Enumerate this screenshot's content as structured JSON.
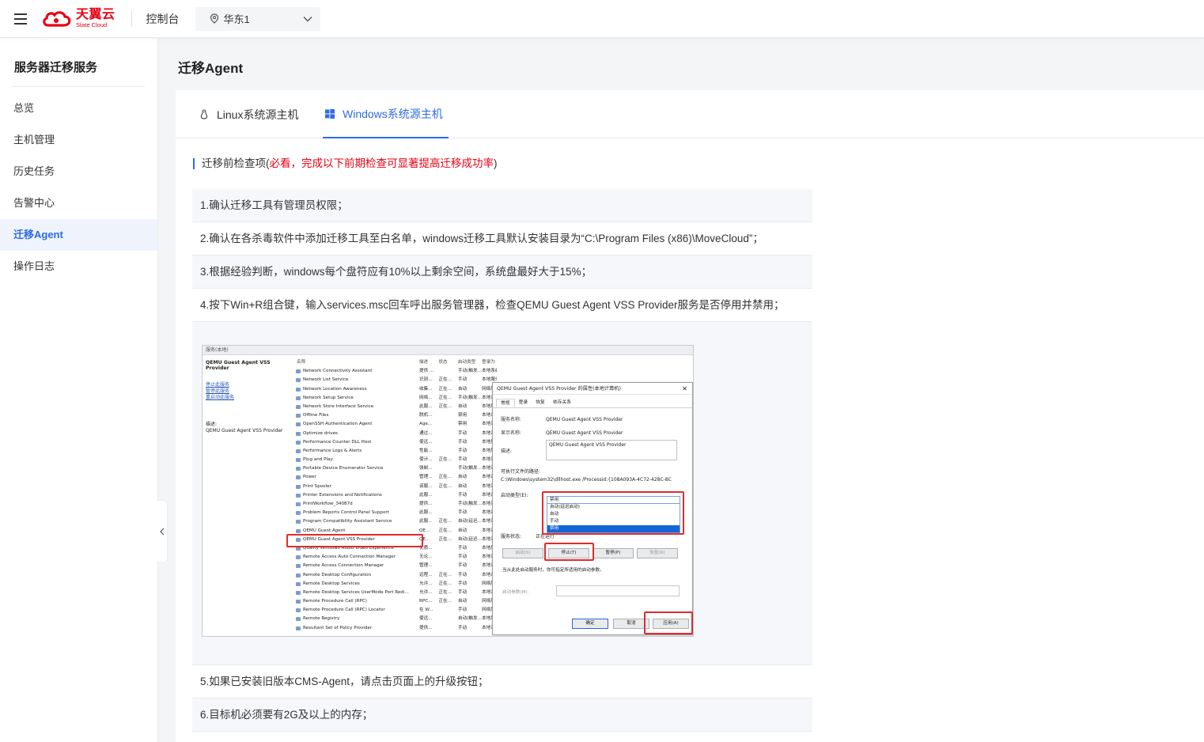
{
  "topbar": {
    "logo_cn": "天翼云",
    "logo_en": "State Cloud",
    "console_label": "控制台",
    "region": "华东1"
  },
  "sidebar": {
    "title": "服务器迁移服务",
    "items": [
      {
        "label": "总览"
      },
      {
        "label": "主机管理"
      },
      {
        "label": "历史任务"
      },
      {
        "label": "告警中心"
      },
      {
        "label": "迁移Agent",
        "active": true
      },
      {
        "label": "操作日志"
      }
    ]
  },
  "page": {
    "title": "迁移Agent",
    "tabs": [
      {
        "label": "Linux系统源主机",
        "icon": "linux-icon",
        "active": false
      },
      {
        "label": "Windows系统源主机",
        "icon": "windows-icon",
        "active": true
      }
    ],
    "precheck": {
      "prefix": "迁移前检查项(",
      "warning": "必看，完成以下前期检查可显著提高迁移成功率",
      "suffix": ")"
    },
    "steps": [
      "1.确认迁移工具有管理员权限；",
      "2.确认在各杀毒软件中添加迁移工具至白名单，windows迁移工具默认安装目录为“C:\\Program Files (x86)\\MoveCloud”；",
      "3.根据经验判断，windows每个盘符应有10%以上剩余空间，系统盘最好大于15%；",
      "4.按下Win+R组合键，输入services.msc回车呼出服务管理器，检查QEMU Guest Agent VSS Provider服务是否停用并禁用；",
      "5.如果已安装旧版本CMS-Agent，请点击页面上的升级按钮；",
      "6.目标机必须要有2G及以上的内存；"
    ]
  },
  "screenshot": {
    "window_title": "服务(本地)",
    "left_title": "QEMU Guest Agent VSS Provider",
    "left_links": [
      "停止此服务",
      "暂停此服务",
      "重启动此服务"
    ],
    "left_desc_label": "描述:",
    "left_desc": "QEMU Guest Agent VSS Provider",
    "columns": [
      "名称",
      "描述",
      "状态",
      "启动类型",
      "登录为"
    ],
    "services": [
      [
        "Network Connectivity Assistant",
        "提供 ...",
        "",
        "手动(触发...",
        "本地系统"
      ],
      [
        "Network List Service",
        "识别...",
        "正在...",
        "手动",
        "本地服务"
      ],
      [
        "Network Location Awareness",
        "收集...",
        "正在...",
        "自动",
        "网络服务"
      ],
      [
        "Network Setup Service",
        "网络...",
        "正在...",
        "手动(触发...",
        "本地系统"
      ],
      [
        "Network Store Interface Service",
        "此服...",
        "正在...",
        "自动",
        "本地服务"
      ],
      [
        "Offline Files",
        "脱机...",
        "",
        "禁用",
        "本地系统"
      ],
      [
        "OpenSSH Authentication Agent",
        "Age...",
        "",
        "禁用",
        "本地系统"
      ],
      [
        "Optimize drives",
        "通过...",
        "",
        "手动",
        "本地系统"
      ],
      [
        "Performance Counter DLL Host",
        "使远...",
        "",
        "手动",
        "本地服务"
      ],
      [
        "Performance Logs & Alerts",
        "性能...",
        "",
        "手动",
        "本地服务"
      ],
      [
        "Plug and Play",
        "使计...",
        "正在...",
        "手动",
        "本地系统"
      ],
      [
        "Portable Device Enumerator Service",
        "强制...",
        "",
        "手动(触发...",
        "本地系统"
      ],
      [
        "Power",
        "管理...",
        "正在...",
        "自动",
        "本地系统"
      ],
      [
        "Print Spooler",
        "该服...",
        "正在...",
        "自动",
        "本地系统"
      ],
      [
        "Printer Extensions and Notifications",
        "此服...",
        "",
        "手动",
        "本地系统"
      ],
      [
        "PrintWorkflow_34087d",
        "提供...",
        "",
        "手动(触发...",
        "本地系统"
      ],
      [
        "Problem Reports Control Panel Support",
        "此服...",
        "",
        "手动",
        "本地系统"
      ],
      [
        "Program Compatibility Assistant Service",
        "此服...",
        "正在...",
        "自动(延迟...",
        "本地系统"
      ],
      [
        "QEMU Guest Agent",
        "QE...",
        "正在...",
        "自动",
        "本地系统"
      ],
      [
        "QEMU Guest Agent VSS Provider",
        "QE...",
        "正在...",
        "自动(延迟...",
        "本地系统"
      ],
      [
        "Quality Windows Audio Video Experience",
        "优质...",
        "",
        "手动",
        "本地服务"
      ],
      [
        "Remote Access Auto Connection Manager",
        "无论...",
        "",
        "手动",
        "本地系统"
      ],
      [
        "Remote Access Connection Manager",
        "管理...",
        "",
        "手动",
        "本地系统"
      ],
      [
        "Remote Desktop Configuration",
        "远程...",
        "正在...",
        "手动",
        "本地系统"
      ],
      [
        "Remote Desktop Services",
        "允许...",
        "正在...",
        "手动",
        "网络服务"
      ],
      [
        "Remote Desktop Services UserMode Port Redi...",
        "允许...",
        "正在...",
        "手动",
        "本地系统"
      ],
      [
        "Remote Procedure Call (RPC)",
        "RPC...",
        "正在...",
        "自动",
        "网络服务"
      ],
      [
        "Remote Procedure Call (RPC) Locator",
        "在 W...",
        "",
        "手动",
        "网络服务"
      ],
      [
        "Remote Registry",
        "使远...",
        "",
        "自动(触发...",
        "本地服务"
      ],
      [
        "Resultant Set of Policy Provider",
        "提供...",
        "",
        "手动",
        "本地系统"
      ]
    ],
    "dialog": {
      "title": "QEMU Guest Agent VSS Provider 的属性(本地计算机)",
      "tabs": [
        "常规",
        "登录",
        "恢复",
        "依存关系"
      ],
      "service_name_label": "服务名称:",
      "service_name": "QEMU Guest Agent VSS Provider",
      "display_name_label": "显示名称:",
      "display_name": "QEMU Guest Agent VSS Provider",
      "desc_label": "描述:",
      "desc": "QEMU Guest Agent VSS Provider",
      "path_label": "可执行文件的路径:",
      "path": "C:\\Windows\\system32\\dllhost.exe /Processid:{108A093A-4C72-428C-8C",
      "startup_label": "启动类型(E):",
      "startup_value": "禁用",
      "startup_options": [
        "自动(延迟启动)",
        "自动",
        "手动",
        "禁用"
      ],
      "status_label": "服务状态:",
      "status_value": "正在运行",
      "buttons": [
        "启动(S)",
        "停止(T)",
        "暂停(P)",
        "恢复(R)"
      ],
      "hint": "当从此处启动服务时，你可指定所适用的启动参数。",
      "param_label": "启动参数(M):",
      "ok": "确定",
      "cancel": "取消",
      "apply": "应用(A)"
    }
  },
  "colors": {
    "accent": "#2e6be6",
    "brand": "#e60012",
    "warning": "#e60012",
    "highlight": "#e12b2b"
  }
}
